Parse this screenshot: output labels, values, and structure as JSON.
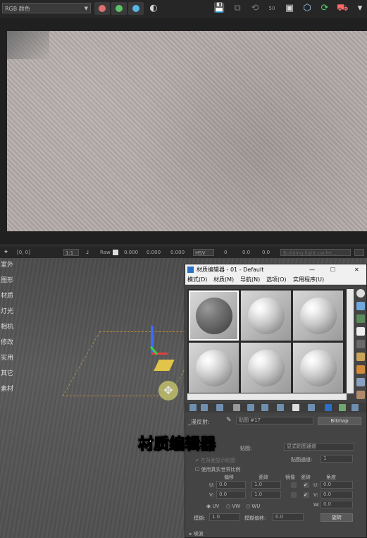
{
  "toolbar": {
    "channel_select": "RGB 颜色",
    "color_dots": [
      "#e07070",
      "#5cc26a",
      "#56b7e6"
    ],
    "icons": [
      "save-icon",
      "clone-icon",
      "history-icon",
      "frame-icon",
      "region-icon",
      "sync-icon",
      "render-icon"
    ],
    "zoom_label": "50"
  },
  "status": {
    "coords": "[0, 0]",
    "zoom": "1:1",
    "raw_label": "Raw",
    "values": [
      "0.000",
      "0.000",
      "0.000"
    ],
    "mode": "HSV",
    "hsv": [
      "0",
      "0.0",
      "0.0"
    ],
    "message": "Building light cache..."
  },
  "command_panel": [
    "室外",
    "图形",
    "材质",
    "灯光",
    "相机",
    "修改",
    "实用",
    "其它",
    "素材"
  ],
  "material_editor": {
    "title": "材质编辑器 - 01 - Default",
    "menu": [
      "模式(D)",
      "材质(M)",
      "导航(N)",
      "选项(O)",
      "实用程序(U)"
    ],
    "map_label": "_漫反射:",
    "map_name": "贴图 #17",
    "map_type": "Bitmap",
    "mapping_label": "贴图:",
    "mapping_value": "显式贴图通道",
    "channel_label": "贴图通道:",
    "channel_value": "1",
    "realworld": "使用真实世界比例",
    "show_map": "在背面显示贴图",
    "headers": [
      "偏移",
      "瓷砖",
      "镜像",
      "瓷砖",
      "角度"
    ],
    "u_offset": "0.0",
    "v_offset": "0.0",
    "u_tile": "1.0",
    "v_tile": "1.0",
    "u_angle": "0.0",
    "v_angle": "0.0",
    "w_angle": "0.0",
    "uv_options": [
      "UV",
      "VW",
      "WU"
    ],
    "blur_label": "模糊:",
    "blur_value": "1.0",
    "blur_offset_label": "模糊偏移:",
    "blur_offset_value": "0.0",
    "rotate_button": "旋转",
    "noise_section": "噪波"
  },
  "subtitle": "材质编辑器"
}
